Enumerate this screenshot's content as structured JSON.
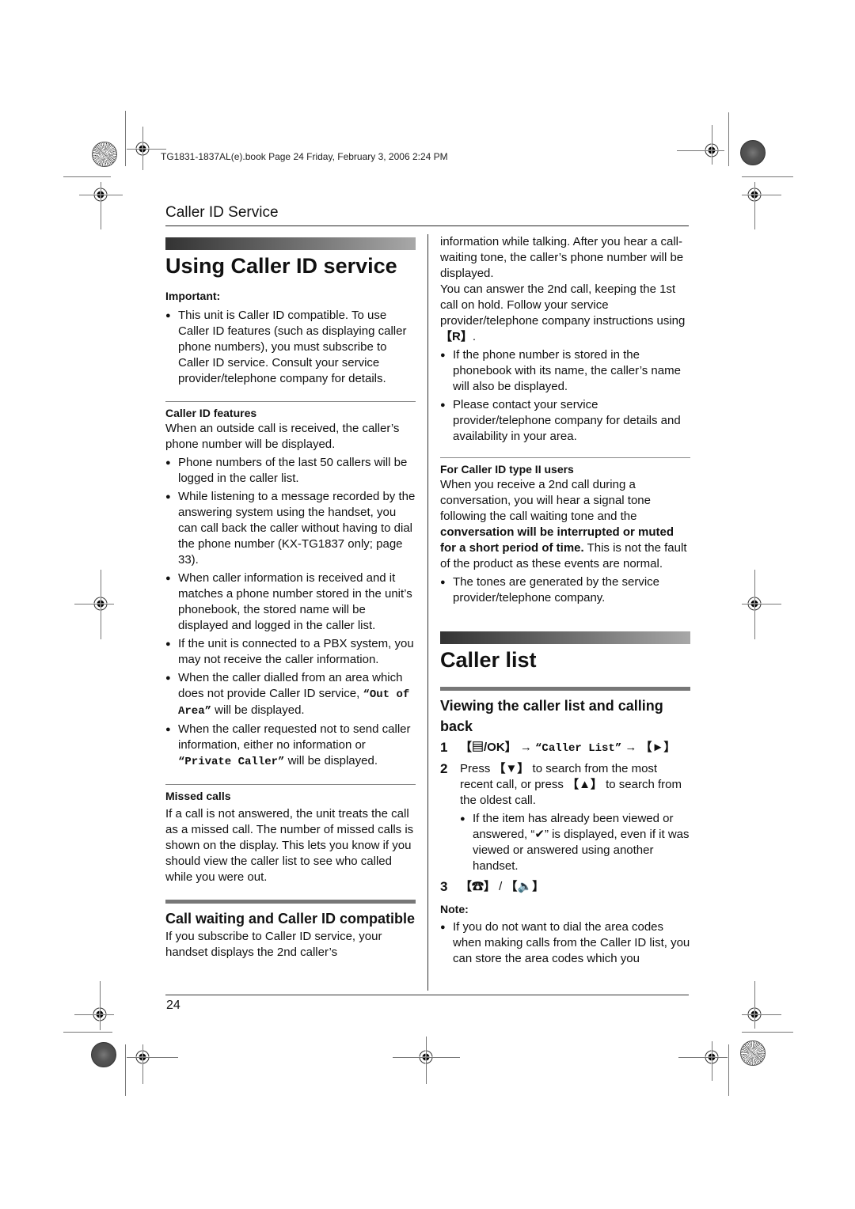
{
  "book_header": "TG1831-1837AL(e).book  Page 24  Friday, February 3, 2006  2:24 PM",
  "section_header": "Caller ID Service",
  "page_number": "24",
  "left": {
    "title": "Using Caller ID service",
    "important_label": "Important:",
    "important_bullets": [
      "This unit is Caller ID compatible. To use Caller ID features (such as displaying caller phone numbers), you must subscribe to Caller ID service. Consult your service provider/telephone company for details."
    ],
    "features_label": "Caller ID features",
    "features_intro": "When an outside call is received, the caller’s phone number will be displayed.",
    "features_bullets": [
      "Phone numbers of the last 50 callers will be logged in the caller list.",
      "While listening to a message recorded by the answering system using the handset, you can call back the caller without having to dial the phone number (KX-TG1837 only; page 33).",
      "When caller information is received and it matches a phone number stored in the unit’s phonebook, the stored name will be displayed and logged in the caller list.",
      "If the unit is connected to a PBX system, you may not receive the caller information."
    ],
    "out_of_area": {
      "pre": "When the caller dialled from an area which does not provide Caller ID service, ",
      "display": "“Out of Area”",
      "post": " will be displayed."
    },
    "private_caller": {
      "pre": "When the caller requested not to send caller information, either no information or ",
      "display": "“Private Caller”",
      "post": " will be displayed."
    },
    "missed_label": "Missed calls",
    "missed_text": "If a call is not answered, the unit treats the call as a missed call. The number of missed calls is shown on the display. This lets you know if you should view the caller list to see who called while you were out.",
    "call_waiting_title": "Call waiting and Caller ID compatible",
    "call_waiting_text": "If you subscribe to Caller ID service, your handset displays the 2nd caller’s"
  },
  "right": {
    "cont_text": "information while talking. After you hear a call-waiting tone, the caller’s phone number will be displayed.",
    "answer_text_pre": "You can answer the 2nd call, keeping the 1st call on hold. Follow your service provider/telephone company instructions using ",
    "answer_key": "【R】",
    "answer_text_post": ".",
    "bullets": [
      "If the phone number is stored in the phonebook with its name, the caller’s name will also be displayed.",
      "Please contact your service provider/telephone company for details and availability in your area."
    ],
    "type2_label": "For Caller ID type II users",
    "type2_text_pre": "When you receive a 2nd call during a conversation, you will hear a signal tone following the call waiting tone and the ",
    "type2_text_bold": "conversation will be interrupted or muted for a short period of time.",
    "type2_text_post": " This is not the fault of the product as these events are normal.",
    "type2_bullet": "The tones are generated by the service provider/telephone company.",
    "caller_list_title": "Caller list",
    "viewing_title": "Viewing the caller list and calling back",
    "steps": [
      {
        "num": "1",
        "key_menu": "【▤/OK】",
        "arrow": " → ",
        "display": "“Caller List”",
        "arrow2": " → ",
        "key_right": "【►】"
      },
      {
        "num": "2",
        "text_pre": "Press ",
        "key_down": "【▼】",
        "text_mid": " to search from the most recent call, or press ",
        "key_up": "【▲】",
        "text_post": " to search from the oldest call.",
        "sub_bullet": "If the item has already been viewed or answered, “✔” is displayed, even if it was viewed or answered using another handset."
      },
      {
        "num": "3",
        "key_talk": "【☎】",
        "sep": " / ",
        "key_speaker": "【🔈】"
      }
    ],
    "note_label": "Note:",
    "note_bullet": "If you do not want to dial the area codes when making calls from the Caller ID list, you can store the area codes which you"
  }
}
